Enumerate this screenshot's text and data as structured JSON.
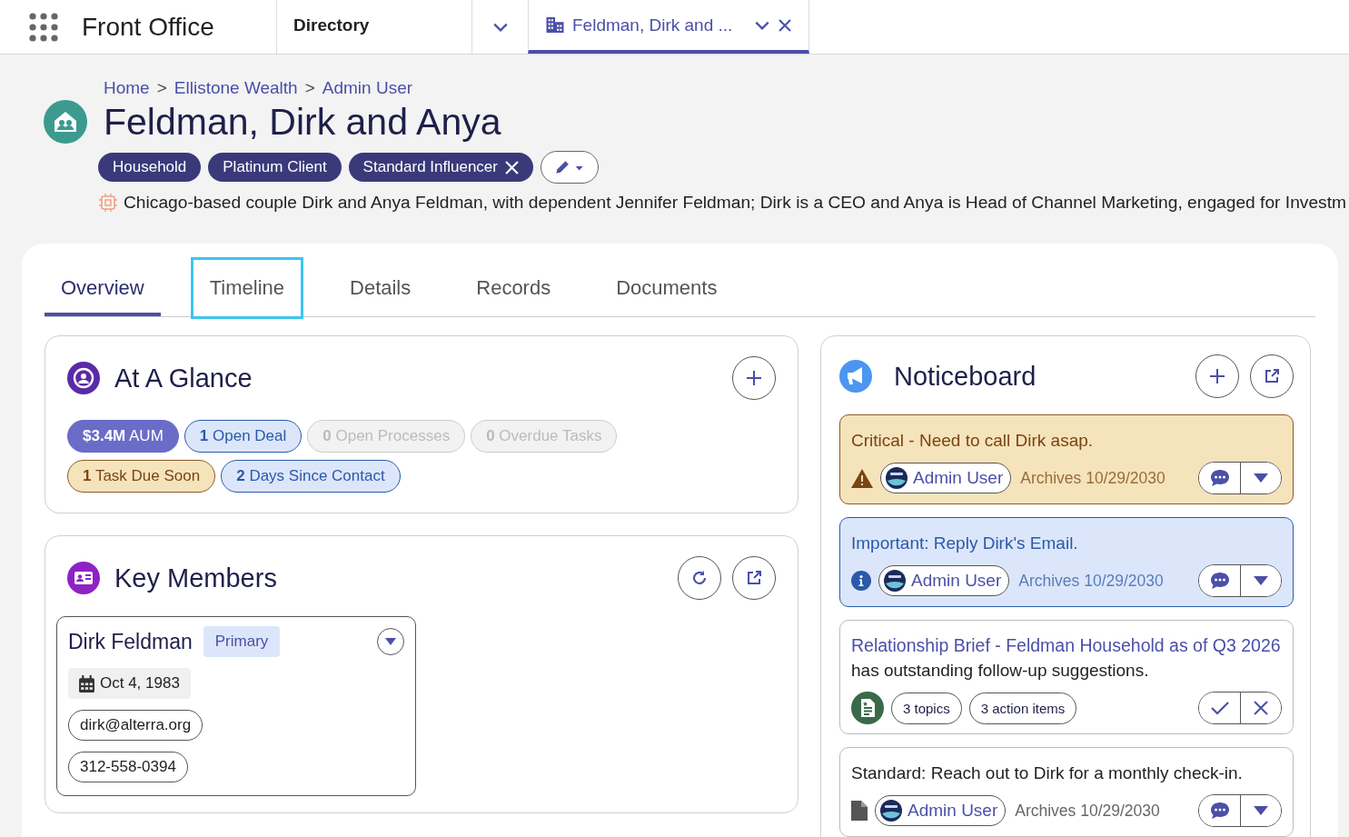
{
  "app_bar": {
    "title": "Front Office",
    "tabs": [
      {
        "label": "Directory",
        "kind": "plain",
        "selected": false
      },
      {
        "label": "Feldman, Dirk and ...",
        "kind": "record",
        "selected": true
      }
    ]
  },
  "breadcrumb": {
    "separator": ">",
    "items": [
      "Home",
      "Ellistone Wealth",
      "Admin User"
    ]
  },
  "title": "Feldman, Dirk and Anya",
  "tags": [
    {
      "label": "Household",
      "removable": false
    },
    {
      "label": "Platinum Client",
      "removable": false
    },
    {
      "label": "Standard Influencer",
      "removable": true
    }
  ],
  "summary": "Chicago-based couple Dirk and Anya Feldman, with dependent Jennifer Feldman; Dirk is a CEO and Anya is Head of Channel Marketing, engaged for Investm",
  "tabs": [
    {
      "label": "Overview",
      "selected": true,
      "focused": false
    },
    {
      "label": "Timeline",
      "selected": false,
      "focused": true
    },
    {
      "label": "Details",
      "selected": false,
      "focused": false
    },
    {
      "label": "Records",
      "selected": false,
      "focused": false
    },
    {
      "label": "Documents",
      "selected": false,
      "focused": false
    }
  ],
  "at_a_glance": {
    "title": "At A Glance",
    "chips": [
      {
        "count": "$3.4M",
        "label": "AUM",
        "kind": "primary"
      },
      {
        "count": "1",
        "label": "Open Deal",
        "kind": "info"
      },
      {
        "count": "0",
        "label": "Open Processes",
        "kind": "muted"
      },
      {
        "count": "0",
        "label": "Overdue Tasks",
        "kind": "muted"
      },
      {
        "count": "1",
        "label": "Task Due Soon",
        "kind": "warning"
      },
      {
        "count": "2",
        "label": "Days Since Contact",
        "kind": "info"
      }
    ]
  },
  "key_members": {
    "title": "Key Members",
    "members": [
      {
        "name": "Dirk Feldman",
        "badge": "Primary",
        "birthday": "Oct 4, 1983",
        "email": "dirk@alterra.org",
        "phone": "312-558-0394"
      }
    ]
  },
  "noticeboard": {
    "title": "Noticeboard",
    "notices": [
      {
        "kind": "critical",
        "text": "Critical - Need to call Dirk asap.",
        "author": "Admin User",
        "archives": "Archives 10/29/2030"
      },
      {
        "kind": "important",
        "text": "Important: Reply Dirk's Email.",
        "author": "Admin User",
        "archives": "Archives 10/29/2030"
      },
      {
        "kind": "brief",
        "link": "Relationship Brief - Feldman Household as of Q3 2026",
        "text": "has outstanding follow-up suggestions.",
        "chips": [
          "3 topics",
          "3 action items"
        ]
      },
      {
        "kind": "standard",
        "text": "Standard: Reach out to Dirk for a monthly check-in.",
        "author": "Admin User",
        "archives": "Archives 10/29/2030"
      }
    ]
  }
}
